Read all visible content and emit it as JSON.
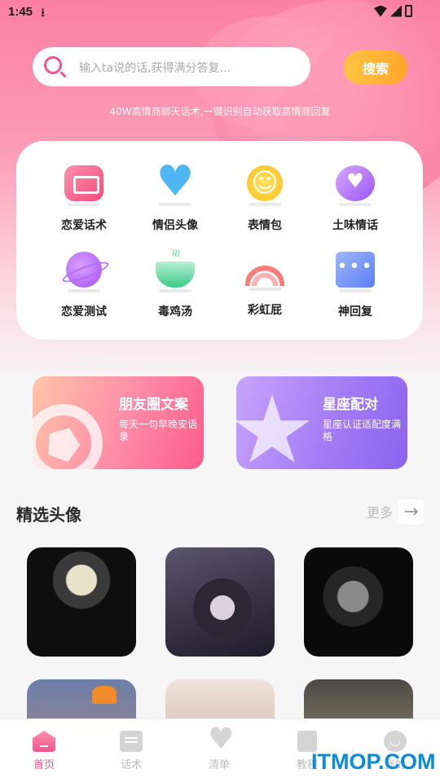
{
  "status_bar": {
    "time": "1:45",
    "download_glyph": "⭳"
  },
  "search": {
    "placeholder": "输入ta说的话,获得满分答复...",
    "button_label": "搜索"
  },
  "subtitle": "40W高情商聊天话术,一键识别自动获取高情商回复",
  "features": [
    {
      "label": "恋爱话术",
      "icon": "message-square-icon"
    },
    {
      "label": "情侣头像",
      "icon": "heart-icon"
    },
    {
      "label": "表情包",
      "icon": "smiley-icon"
    },
    {
      "label": "土味情话",
      "icon": "heart-bubble-icon"
    },
    {
      "label": "恋爱测试",
      "icon": "planet-icon"
    },
    {
      "label": "毒鸡汤",
      "icon": "soup-bowl-icon"
    },
    {
      "label": "彩虹屁",
      "icon": "rainbow-icon"
    },
    {
      "label": "神回复",
      "icon": "chat-dots-icon"
    }
  ],
  "promos": [
    {
      "title": "朋友圈文案",
      "desc": "每天一句早晚安语录",
      "icon": "aperture-icon"
    },
    {
      "title": "星座配对",
      "desc": "星座认证适配度满格",
      "icon": "star-icon"
    }
  ],
  "avatars_section": {
    "title": "精选头像",
    "more_label": "更多",
    "more_glyph": "→"
  },
  "tabbar": [
    {
      "label": "首页",
      "icon": "home-icon",
      "active": true
    },
    {
      "label": "话术",
      "icon": "message-icon",
      "active": false
    },
    {
      "label": "清单",
      "icon": "heart-icon",
      "active": false
    },
    {
      "label": "教程",
      "icon": "book-icon",
      "active": false
    },
    {
      "label": "我的",
      "icon": "profile-icon",
      "active": false
    }
  ],
  "watermark": "ITMOP.COM",
  "colors": {
    "accent_pink": "#f0568c",
    "search_button": "#ffb234",
    "watermark": "#0a8bd8"
  }
}
